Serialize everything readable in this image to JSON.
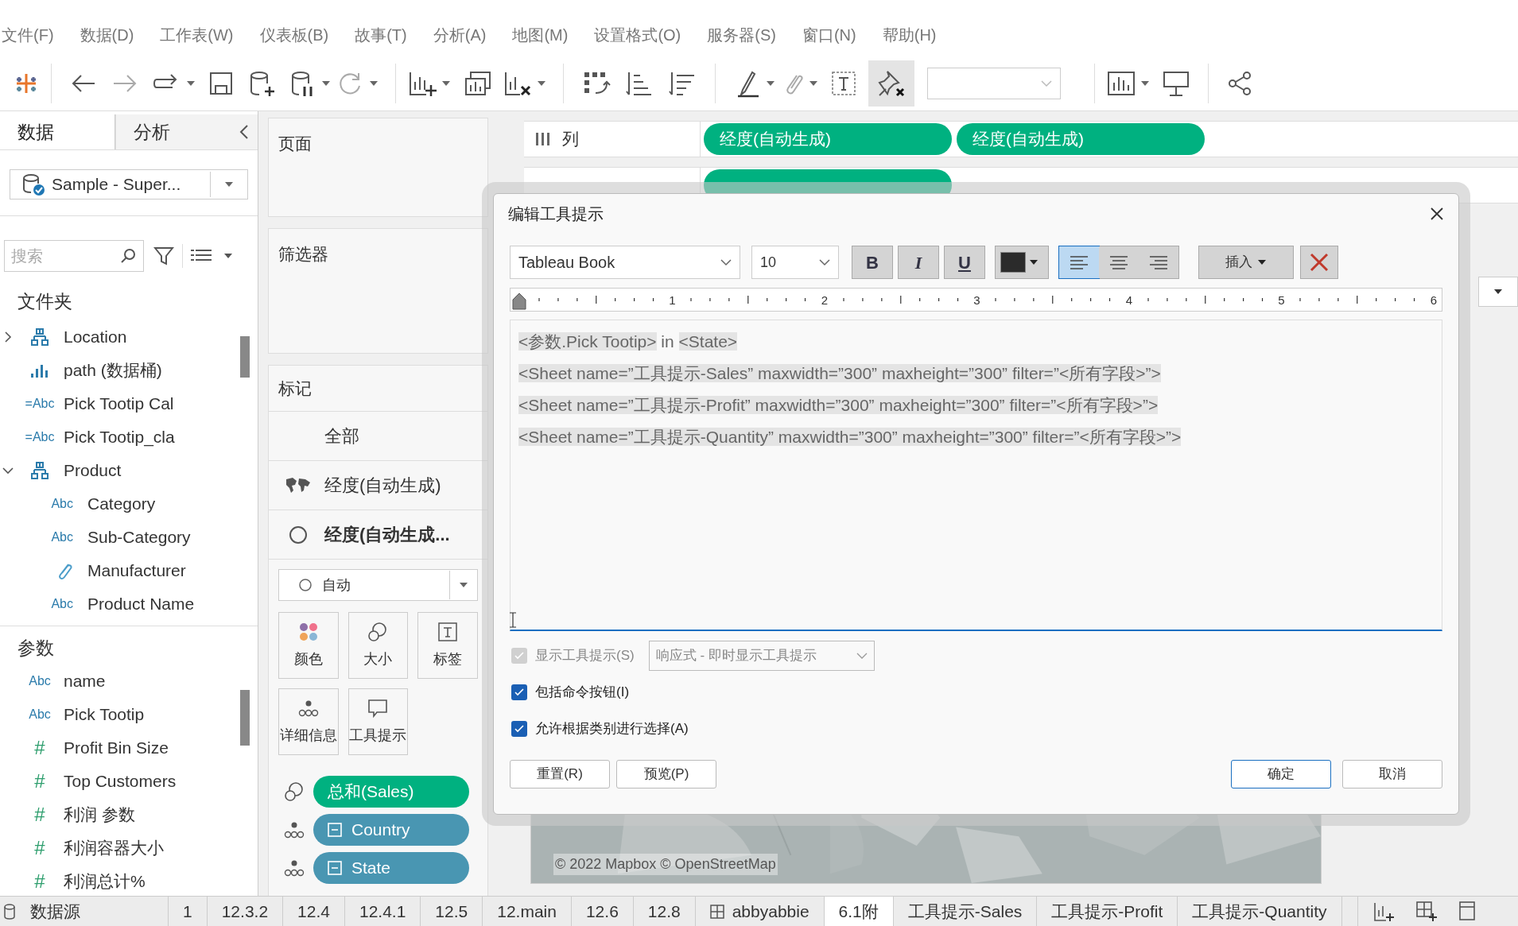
{
  "menu": [
    "文件(F)",
    "数据(D)",
    "工作表(W)",
    "仪表板(B)",
    "故事(T)",
    "分析(A)",
    "地图(M)",
    "设置格式(O)",
    "服务器(S)",
    "窗口(N)",
    "帮助(H)"
  ],
  "data_pane": {
    "tabs": [
      {
        "label": "数据",
        "selected": true
      },
      {
        "label": "分析",
        "selected": false
      }
    ],
    "datasource": "Sample - Super...",
    "search": {
      "placeholder": "搜索"
    },
    "folders_heading": "文件夹",
    "fields": [
      {
        "kind": "hierarchy",
        "label": "Location",
        "expanded": false
      },
      {
        "kind": "bin",
        "label": "path (数据桶)"
      },
      {
        "kind": "calc",
        "badge": "=Abc",
        "label": "Pick Tootip Cal"
      },
      {
        "kind": "calc",
        "badge": "=Abc",
        "label": "Pick Tootip_cla"
      },
      {
        "kind": "hierarchy",
        "label": "Product",
        "expanded": true,
        "children": [
          {
            "kind": "string",
            "badge": "Abc",
            "label": "Category"
          },
          {
            "kind": "string",
            "badge": "Abc",
            "label": "Sub-Category"
          },
          {
            "kind": "group",
            "label": "Manufacturer"
          },
          {
            "kind": "string",
            "badge": "Abc",
            "label": "Product Name"
          }
        ]
      }
    ],
    "parameters_heading": "参数",
    "parameters": [
      {
        "kind": "string",
        "badge": "Abc",
        "label": "name"
      },
      {
        "kind": "string",
        "badge": "Abc",
        "label": "Pick Tootip"
      },
      {
        "kind": "number",
        "badge": "#",
        "label": "Profit Bin Size"
      },
      {
        "kind": "number",
        "badge": "#",
        "label": "Top Customers"
      },
      {
        "kind": "number",
        "badge": "#",
        "label": "利润 参数"
      },
      {
        "kind": "number",
        "badge": "#",
        "label": "利润容器大小"
      },
      {
        "kind": "number",
        "badge": "#",
        "label": "利润总计%"
      }
    ]
  },
  "cards": {
    "pages": "页面",
    "filters": "筛选器",
    "marks": {
      "title": "标记",
      "layers": [
        {
          "kind": "all",
          "label": "全部",
          "selected": false
        },
        {
          "kind": "map",
          "label": "经度(自动生成)",
          "selected": false
        },
        {
          "kind": "circle",
          "label": "经度(自动生成...",
          "selected": true
        }
      ],
      "mark_type": "自动",
      "buttons": [
        {
          "kind": "color",
          "label": "颜色"
        },
        {
          "kind": "size",
          "label": "大小"
        },
        {
          "kind": "label",
          "label": "标签"
        },
        {
          "kind": "detail",
          "label": "详细信息"
        },
        {
          "kind": "tooltip",
          "label": "工具提示"
        }
      ],
      "pills": [
        {
          "kind": "size",
          "label": "总和(Sales)",
          "color": "#00b180",
          "dimension": false
        },
        {
          "kind": "detail",
          "label": "Country",
          "color": "#4996b2",
          "dimension": true
        },
        {
          "kind": "detail",
          "label": "State",
          "color": "#4996b2",
          "dimension": true
        }
      ]
    }
  },
  "columns_shelf": {
    "label": "列",
    "pills": [
      {
        "label": "经度(自动生成)"
      },
      {
        "label": "经度(自动生成)"
      }
    ]
  },
  "map": {
    "attribution": "© 2022 Mapbox © OpenStreetMap"
  },
  "dialog": {
    "title": "编辑工具提示",
    "font": "Tableau Book",
    "size": "10",
    "format_buttons": [
      {
        "kind": "bold",
        "label": "B"
      },
      {
        "kind": "italic",
        "label": "I"
      },
      {
        "kind": "underline",
        "label": "U"
      }
    ],
    "alignment": [
      {
        "kind": "left",
        "selected": true
      },
      {
        "kind": "center",
        "selected": false
      },
      {
        "kind": "right",
        "selected": false
      }
    ],
    "insert_button": "插入",
    "ruler": [
      "1",
      "2",
      "3",
      "4",
      "5",
      "6"
    ],
    "lines": [
      [
        {
          "text": "<参数.Pick Tootip>",
          "highlighted": true
        },
        {
          "text": " in ",
          "highlighted": false
        },
        {
          "text": "<State>",
          "highlighted": true
        }
      ],
      [
        {
          "text": "<Sheet name=”工具提示-Sales” maxwidth=”300” maxheight=”300” filter=”<所有字段>”>",
          "highlighted": true
        }
      ],
      [
        {
          "text": "<Sheet name=”工具提示-Profit” maxwidth=”300” maxheight=”300” filter=”<所有字段>”>",
          "highlighted": true
        }
      ],
      [
        {
          "text": "<Sheet name=”工具提示-Quantity” maxwidth=”300” maxheight=”300” filter=”<所有字段>”>",
          "highlighted": true
        }
      ]
    ],
    "options": [
      {
        "label": "显示工具提示(S)",
        "checked": true,
        "disabled": true
      },
      {
        "label": "包括命令按钮(I)",
        "checked": true,
        "disabled": false
      },
      {
        "label": "允许根据类别进行选择(A)",
        "checked": true,
        "disabled": false
      }
    ],
    "tooltip_mode": "响应式 - 即时显示工具提示",
    "buttons": [
      {
        "label": "重置(R)",
        "kind": "secondary"
      },
      {
        "label": "预览(P)",
        "kind": "secondary"
      },
      {
        "label": "确定",
        "kind": "primary"
      },
      {
        "label": "取消",
        "kind": "secondary"
      }
    ]
  },
  "sheet_tabs": [
    {
      "label": "数据源",
      "kind": "datasource",
      "selected": false
    },
    {
      "label": "1",
      "kind": "sheet",
      "selected": false
    },
    {
      "label": "12.3.2",
      "kind": "sheet",
      "selected": false
    },
    {
      "label": "12.4",
      "kind": "sheet",
      "selected": false
    },
    {
      "label": "12.4.1",
      "kind": "sheet",
      "selected": false
    },
    {
      "label": "12.5",
      "kind": "sheet",
      "selected": false
    },
    {
      "label": "12.main",
      "kind": "sheet",
      "selected": false
    },
    {
      "label": "12.6",
      "kind": "sheet",
      "selected": false
    },
    {
      "label": "12.8",
      "kind": "sheet",
      "selected": false
    },
    {
      "label": "abbyabbie",
      "kind": "dashboard",
      "selected": false
    },
    {
      "label": "6.1附",
      "kind": "sheet",
      "selected": true
    },
    {
      "label": "工具提示-Sales",
      "kind": "sheet",
      "selected": false
    },
    {
      "label": "工具提示-Profit",
      "kind": "sheet",
      "selected": false
    },
    {
      "label": "工具提示-Quantity",
      "kind": "sheet",
      "selected": false
    }
  ]
}
